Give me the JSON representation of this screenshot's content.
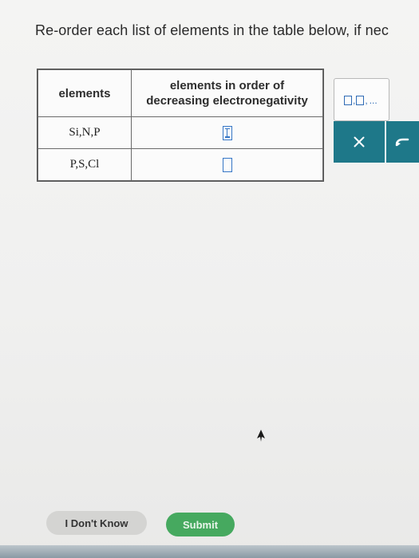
{
  "question": {
    "text": "Re-order each list of elements in the table below, if nec"
  },
  "table": {
    "headers": {
      "elements": "elements",
      "order_line1": "elements in order of",
      "order_line2": "decreasing electronegativity"
    },
    "rows": [
      {
        "elements": "Si,N,P",
        "answer": ""
      },
      {
        "elements": "P,S,Cl",
        "answer": ""
      }
    ]
  },
  "palette": {
    "sep1": ",",
    "sep2": ",",
    "ellipsis": "..."
  },
  "toolbar": {
    "clear_icon": "x-icon",
    "undo_icon": "undo-arrow-icon",
    "color": "#1e7889"
  },
  "buttons": {
    "dont_know": "I Don't Know",
    "submit": "Submit"
  },
  "colors": {
    "accent_blue": "#3576c6",
    "submit_green": "#46a95f"
  }
}
